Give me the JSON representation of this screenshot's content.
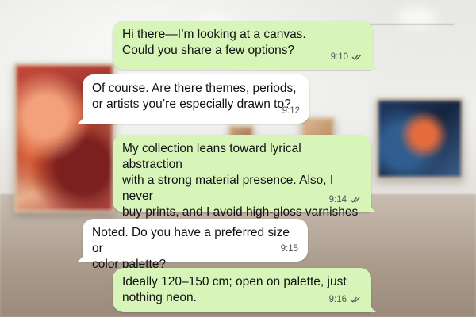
{
  "messages": [
    {
      "direction": "outgoing",
      "text": "Hi there—I’m looking at a canvas.\nCould you share a few options?",
      "time": "9:10",
      "status_icon": "double-check-icon"
    },
    {
      "direction": "incoming",
      "text": "Of course. Are there themes, periods,\nor artists you’re especially drawn to?",
      "time": "9:12"
    },
    {
      "direction": "outgoing",
      "text": "My collection leans toward lyrical abstraction\nwith a strong material presence. Also, I never\nbuy prints, and I avoid high-gloss varnishes\nor heavy frames.",
      "time": "9:14",
      "status_icon": "double-check-icon"
    },
    {
      "direction": "incoming",
      "text": "Noted. Do you have a preferred size or\ncolor palette?",
      "time": "9:15"
    },
    {
      "direction": "outgoing",
      "text": "Ideally 120–150 cm; open on palette, just\nnothing neon.",
      "time": "9:16",
      "status_icon": "double-check-icon"
    }
  ],
  "colors": {
    "outgoing_bubble": "#d8f5b9",
    "incoming_bubble": "#ffffff",
    "text": "#111111",
    "timestamp": "#555555"
  }
}
